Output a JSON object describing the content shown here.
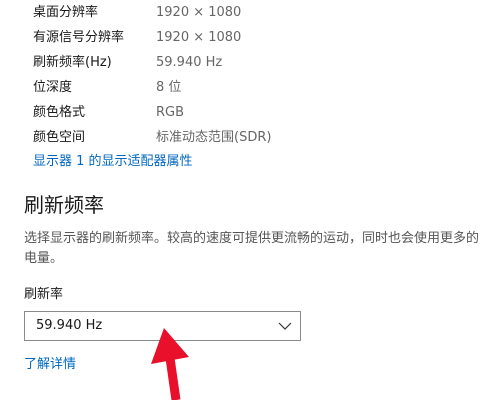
{
  "display_info": {
    "rows": [
      {
        "label": "桌面分辨率",
        "value": "1920 × 1080"
      },
      {
        "label": "有源信号分辨率",
        "value": "1920 × 1080"
      },
      {
        "label": "刷新频率(Hz)",
        "value": "59.940 Hz"
      },
      {
        "label": "位深度",
        "value": "8 位"
      },
      {
        "label": "颜色格式",
        "value": "RGB"
      },
      {
        "label": "颜色空间",
        "value": "标准动态范围(SDR)"
      }
    ],
    "adapter_link": "显示器 1 的显示适配器属性"
  },
  "refresh_section": {
    "title": "刷新频率",
    "description": "选择显示器的刷新频率。较高的速度可提供更流畅的运动，同时也会使用更多的电量。",
    "rate_label": "刷新率",
    "rate_selected": "59.940 Hz",
    "learn_more": "了解详情"
  },
  "colors": {
    "link": "#0067c0",
    "annotation_arrow": "#e8102a"
  },
  "icons": {
    "dropdown": "chevron-down-icon",
    "annotation": "red-arrow-annotation"
  }
}
